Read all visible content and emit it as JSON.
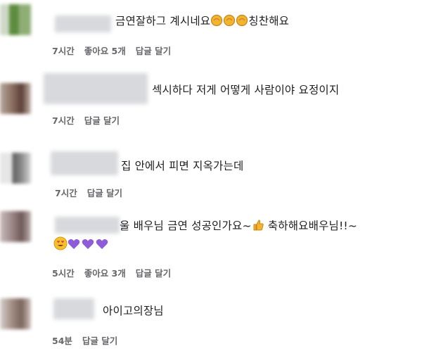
{
  "comments": [
    {
      "text_before": "금연잘하그 계시네요",
      "text_after": "칭찬해요",
      "emojis": [
        "clapping-hands-icon",
        "clapping-hands-icon",
        "clapping-hands-icon"
      ],
      "time": "7시간",
      "like": "좋아요 5개",
      "reply": "답글 달기"
    },
    {
      "text": "섹시하다 저게 어떻게 사람이야 요정이지",
      "time": "7시간",
      "reply": "답글 달기"
    },
    {
      "text": "집 안에서 피면 지옥가는데",
      "time": "7시간",
      "reply": "답글 달기"
    },
    {
      "text_before": "울 배우님 금연 성공인가요~",
      "text_after": "축하해요배우님!!~",
      "time": "5시간",
      "like": "좋아요 3개",
      "reply": "답글 달기",
      "emojis": [
        "thumbs-up-icon",
        "heart-eyes-icon",
        "purple-heart-icon",
        "purple-heart-icon",
        "purple-heart-icon"
      ]
    },
    {
      "text": "아이고의장님",
      "time": "54분",
      "reply": "답글 달기"
    }
  ],
  "colors": {
    "meta": "#65676b",
    "text": "#1c1e21",
    "purple_heart": "#8e5cd9",
    "clap": "#f2b431"
  }
}
